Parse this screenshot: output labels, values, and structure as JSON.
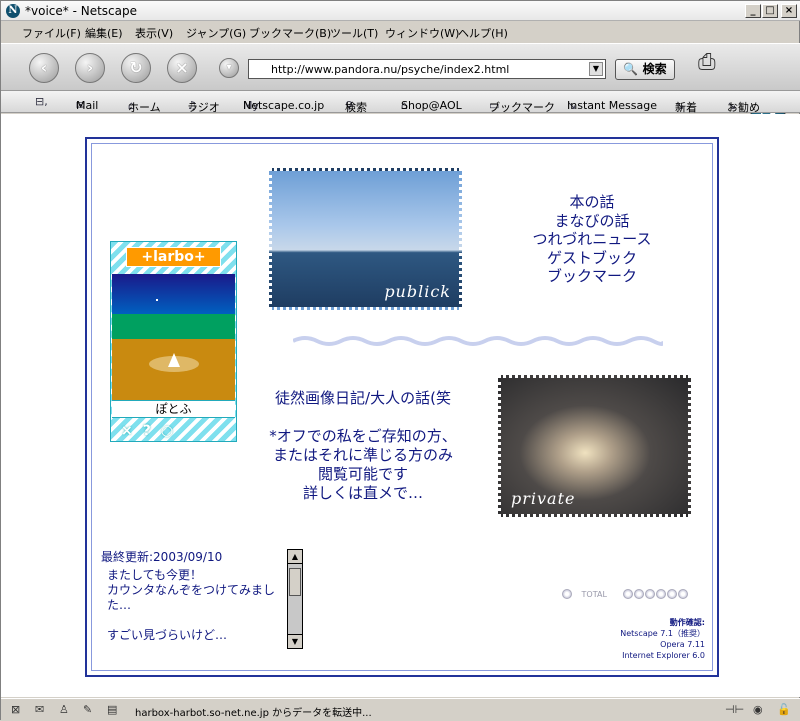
{
  "window": {
    "title": "*voice* - Netscape"
  },
  "menu": [
    "ファイル(F)",
    "編集(E)",
    "表示(V)",
    "ジャンプ(G)",
    "ブックマーク(B)",
    "ツール(T)",
    "ウィンドウ(W)",
    "ヘルプ(H)"
  ],
  "nav": {
    "url": "http://www.pandora.nu/psyche/index2.html",
    "search_label": "検索"
  },
  "personal_toolbar": [
    "Mail",
    "ホーム",
    "ラジオ",
    "Netscape.co.jp",
    "検索",
    "Shop@AOL",
    "ブックマーク",
    "Instant Message",
    "新着",
    "お勧め"
  ],
  "harbot": {
    "logo": "+larbo+",
    "name": "ぽとふ",
    "controls": "×?○"
  },
  "images": {
    "public_caption": "publick",
    "private_caption": "private"
  },
  "links": [
    "本の話",
    "まなびの話",
    "つれづれニュース",
    "ゲストブック",
    "ブックマーク"
  ],
  "diary": [
    "徒然画像日記/大人の話(笑",
    "",
    "*オフでの私をご存知の方、",
    "またはそれに準じる方のみ",
    "閲覧可能です",
    "詳しくは直メで…"
  ],
  "updated": "最終更新:2003/09/10",
  "note": [
    "またしても今更！",
    "カウンタなんぞをつけてみまし",
    "た…",
    "",
    "すごい見づらいけど…"
  ],
  "counter": {
    "label": "TOTAL"
  },
  "compat": [
    "動作確認:",
    "Netscape 7.1（推奨）",
    "Opera 7.11",
    "Internet Explorer 6.0"
  ],
  "status": {
    "text": "harbox-harbot.so-net.ne.jp からデータを転送中..."
  }
}
